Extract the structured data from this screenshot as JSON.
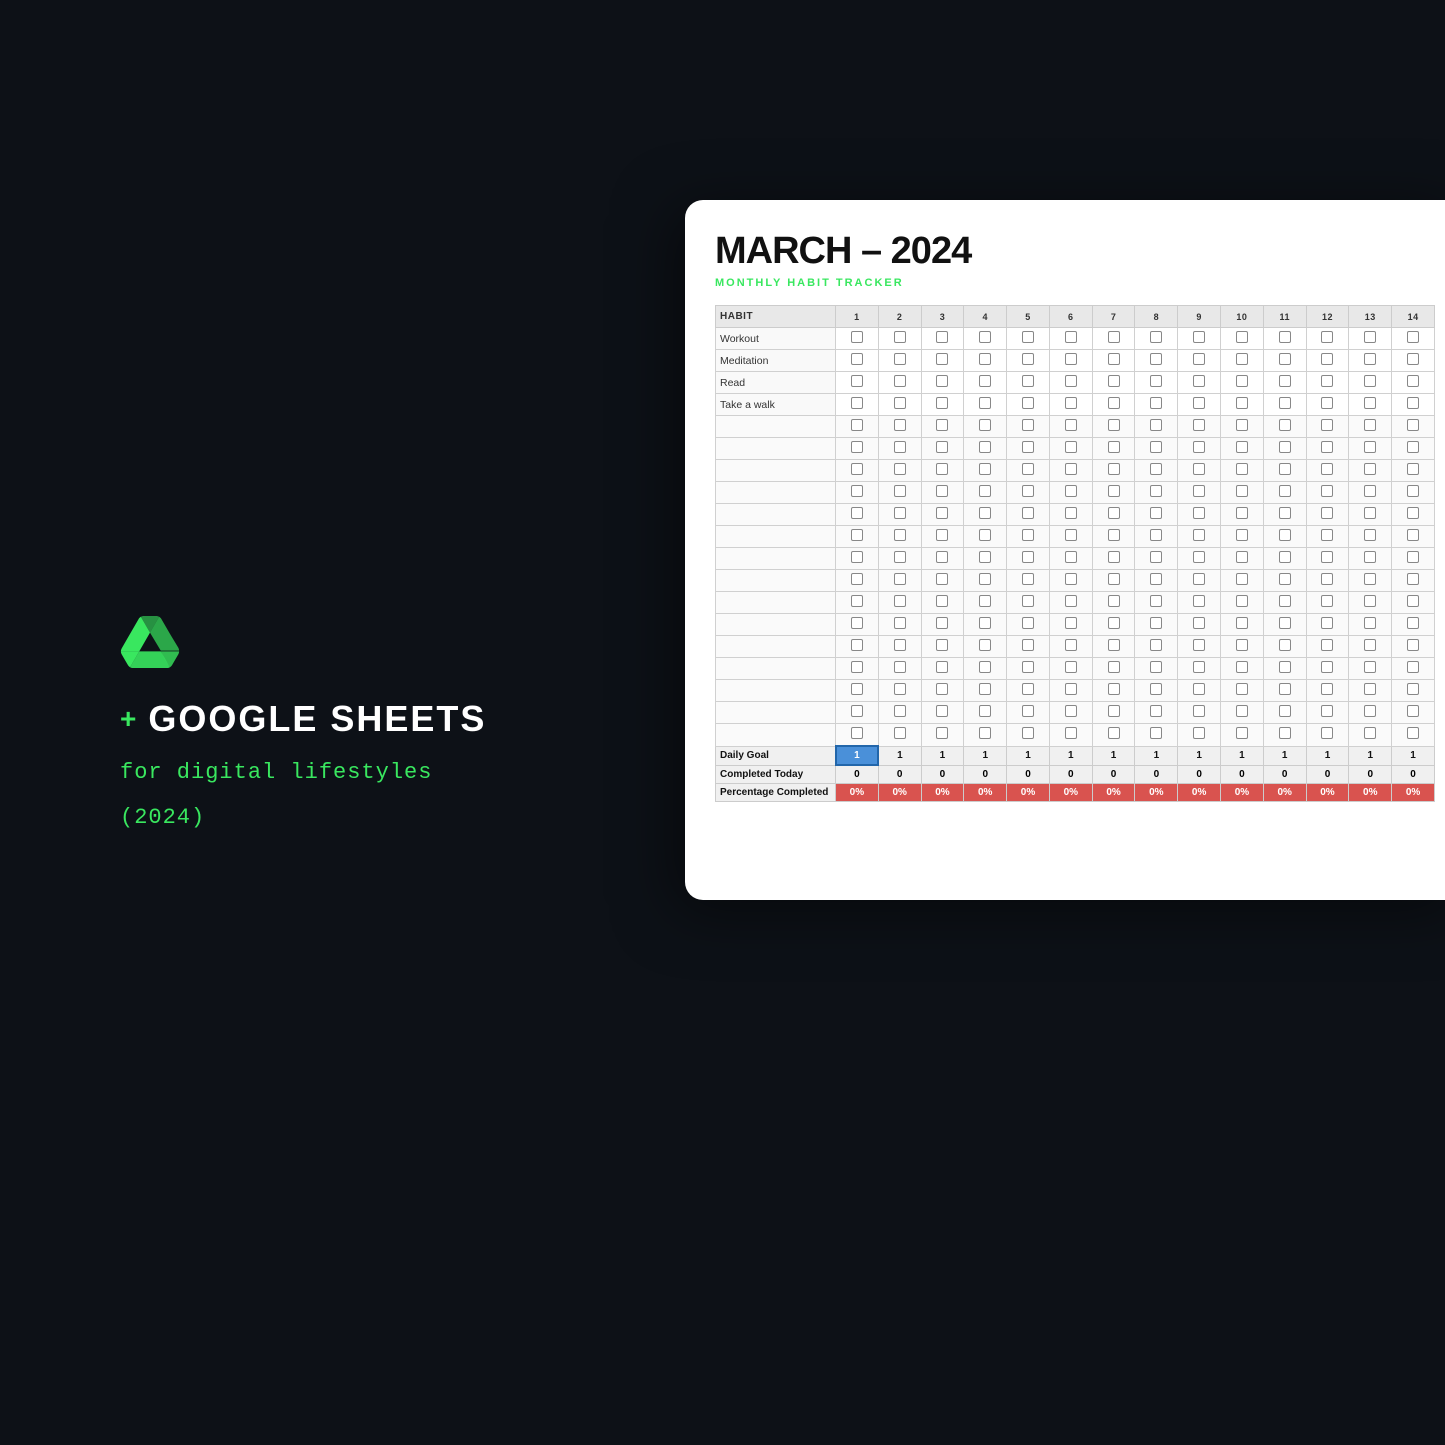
{
  "background": "#0d1117",
  "left": {
    "plus": "+",
    "brand": "GOOGLE SHEETS",
    "tagline": "for digital lifestyles",
    "year": "(2024)"
  },
  "spreadsheet": {
    "title": "MARCH – 2024",
    "subtitle": "MONTHLY HABIT TRACKER",
    "header": {
      "habit_col": "HABIT",
      "days": [
        "1",
        "2",
        "3",
        "4",
        "5",
        "6",
        "7",
        "8",
        "9",
        "10",
        "11",
        "12",
        "13",
        "14"
      ]
    },
    "habits": [
      "Workout",
      "Meditation",
      "Read",
      "Take a walk"
    ],
    "empty_rows": 15,
    "summary": {
      "daily_goal_label": "Daily Goal",
      "completed_label": "Completed Today",
      "percentage_label": "Percentage Completed",
      "daily_goal_values": [
        "1",
        "1",
        "1",
        "1",
        "1",
        "1",
        "1",
        "1",
        "1",
        "1",
        "1",
        "1",
        "1",
        "1"
      ],
      "completed_values": [
        "0",
        "0",
        "0",
        "0",
        "0",
        "0",
        "0",
        "0",
        "0",
        "0",
        "0",
        "0",
        "0",
        "0"
      ],
      "percentage_values": [
        "0%",
        "0%",
        "0%",
        "0%",
        "0%",
        "0%",
        "0%",
        "0%",
        "0%",
        "0%",
        "0%",
        "0%",
        "0%",
        "0%"
      ]
    }
  }
}
